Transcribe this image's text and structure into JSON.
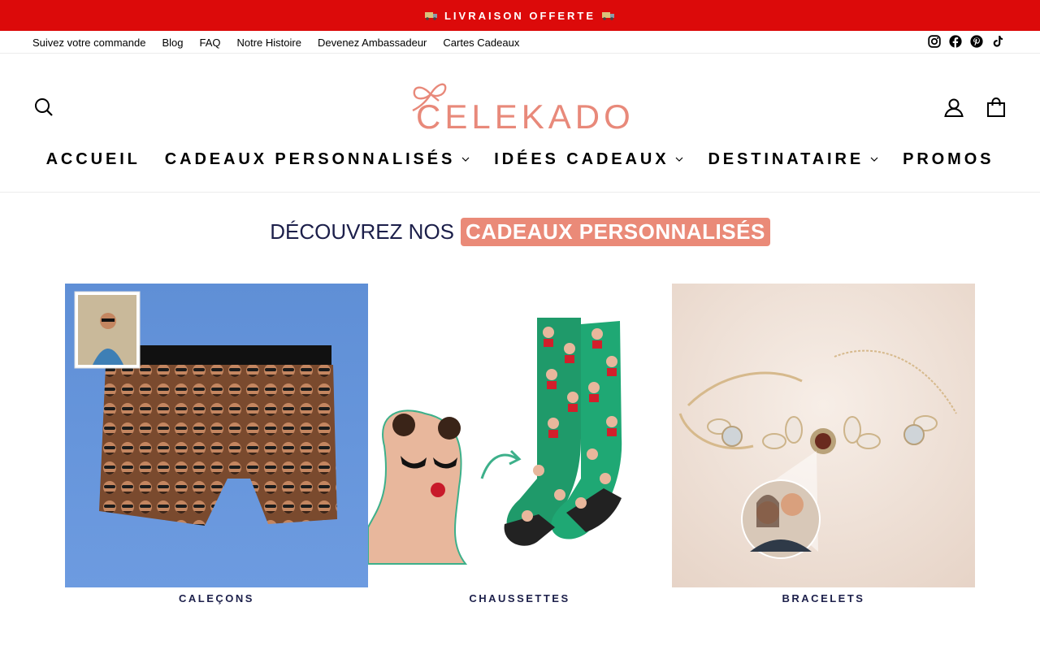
{
  "announcement": {
    "text": "LIVRAISON OFFERTE",
    "icon": "truck-icon"
  },
  "utility_links": [
    {
      "label": "Suivez votre commande"
    },
    {
      "label": "Blog"
    },
    {
      "label": "FAQ"
    },
    {
      "label": "Notre Histoire"
    },
    {
      "label": "Devenez Ambassadeur"
    },
    {
      "label": "Cartes Cadeaux"
    }
  ],
  "social": [
    "instagram-icon",
    "facebook-icon",
    "pinterest-icon",
    "tiktok-icon"
  ],
  "brand": {
    "name": "CELEKADO",
    "color": "#e8897a"
  },
  "nav": [
    {
      "label": "ACCUEIL",
      "dropdown": false
    },
    {
      "label": "CADEAUX PERSONNALISÉS",
      "dropdown": true
    },
    {
      "label": "IDÉES CADEAUX",
      "dropdown": true
    },
    {
      "label": "DESTINATAIRE",
      "dropdown": true
    },
    {
      "label": "PROMOS",
      "dropdown": false
    }
  ],
  "section": {
    "title_part1": "DÉCOUVREZ NOS",
    "title_part2": "CADEAUX PERSONNALISÉS"
  },
  "categories": [
    {
      "label": "CALEÇONS"
    },
    {
      "label": "CHAUSSETTES"
    },
    {
      "label": "BRACELETS"
    }
  ],
  "colors": {
    "announce_bg": "#dc0a0a",
    "accent": "#ea8a78",
    "navy": "#1c1f4a"
  }
}
